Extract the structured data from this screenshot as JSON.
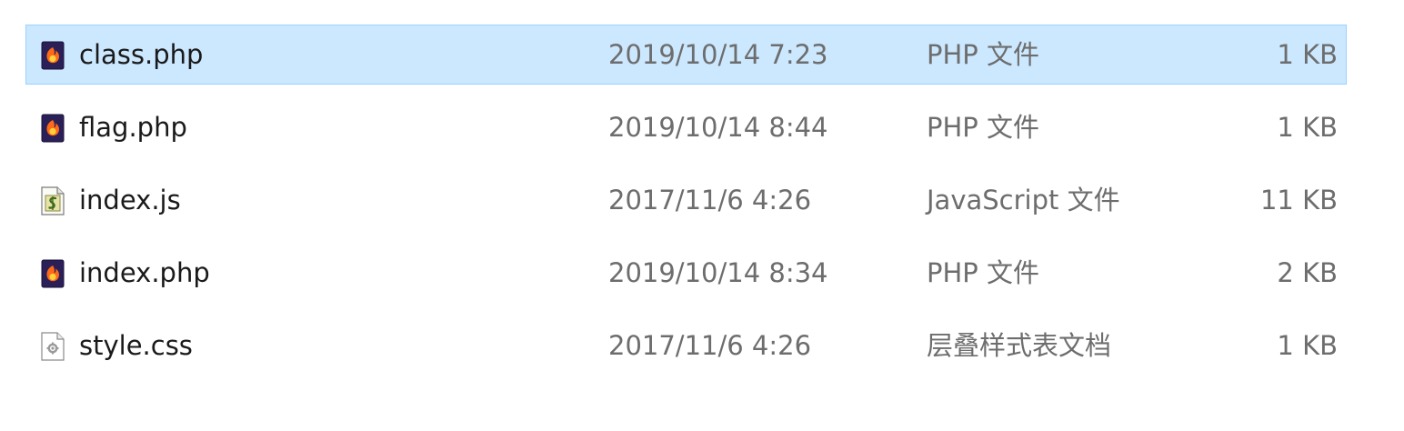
{
  "files": [
    {
      "name": "class.php",
      "date": "2019/10/14 7:23",
      "type": "PHP 文件",
      "size": "1 KB",
      "icon": "php-file-icon",
      "selected": true
    },
    {
      "name": "flag.php",
      "date": "2019/10/14 8:44",
      "type": "PHP 文件",
      "size": "1 KB",
      "icon": "php-file-icon",
      "selected": false
    },
    {
      "name": "index.js",
      "date": "2017/11/6 4:26",
      "type": "JavaScript 文件",
      "size": "11 KB",
      "icon": "javascript-file-icon",
      "selected": false
    },
    {
      "name": "index.php",
      "date": "2019/10/14 8:34",
      "type": "PHP 文件",
      "size": "2 KB",
      "icon": "php-file-icon",
      "selected": false
    },
    {
      "name": "style.css",
      "date": "2017/11/6 4:26",
      "type": "层叠样式表文档",
      "size": "1 KB",
      "icon": "css-file-icon",
      "selected": false
    }
  ],
  "colors": {
    "selection_background": "#cce8ff",
    "selection_border": "#99d1ff",
    "name_text": "#1a1a1a",
    "detail_text": "#6d6d6d"
  }
}
